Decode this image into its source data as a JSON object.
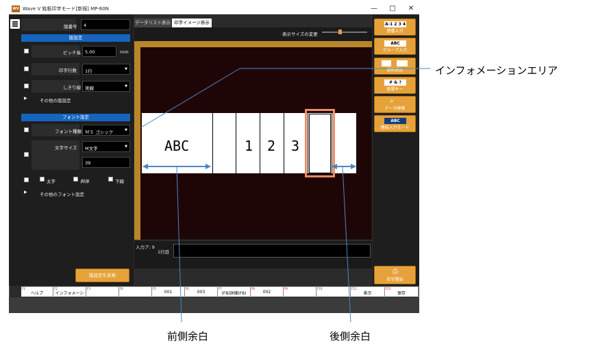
{
  "window": {
    "logo_text": "WV",
    "title": "Wave V 銘板印字モード[新規] MP-60N",
    "minimize": "—",
    "maximize": "□",
    "close": "✕"
  },
  "left": {
    "item_no_label": "版番号",
    "item_no_value": "4",
    "section_layout": "版設定",
    "pitch_label": "ピッチ長",
    "pitch_value": "5.00",
    "pitch_unit": "mm",
    "lines_label": "印字行数",
    "lines_value": "1行",
    "divider_label": "しきり線",
    "divider_value": "実線",
    "more_layout": "その他の版設定",
    "section_font": "フォント設定",
    "font_type_label": "フォント種類",
    "font_type_value": "ＭＳ ゴシック",
    "char_size_label": "文字サイズ",
    "char_size_value": "M文字",
    "char_size_num": "39",
    "bold_label": "太字",
    "italic_label": "斜体",
    "underline_label": "下線",
    "more_font": "その他のフォント設定",
    "apply_label": "版設定を反映"
  },
  "tabs": {
    "data_list": "データリスト表示",
    "print_image": "印字イメージ表示"
  },
  "image": {
    "size_change_label": "表示サイズの変更",
    "slider_fraction": 0.4,
    "cells": [
      "ABC",
      "",
      "1",
      "2",
      "3",
      "",
      ""
    ]
  },
  "input": {
    "input_label": "入力ア: 9",
    "line_label": "1行目"
  },
  "right_buttons": [
    {
      "icon": "A-1 2 3 4",
      "label": "連番入力"
    },
    {
      "icon": "ABC",
      "label": "グループ入力"
    },
    {
      "icon": "",
      "label": "透析読込"
    },
    {
      "icon": "# & ?",
      "label": "仮想キー"
    },
    {
      "icon": "",
      "label": "データ検索"
    },
    {
      "icon": "ABC",
      "label": "連結入力モード"
    }
  ],
  "print_button": "印字開始",
  "fn_bar": [
    {
      "key": "F1",
      "label": "ヘルプ"
    },
    {
      "key": "F2",
      "label": "インフォメーション"
    },
    {
      "key": "F3",
      "label": ""
    },
    {
      "key": "F4",
      "label": ""
    },
    {
      "key": "F5",
      "label": "001"
    },
    {
      "key": "F6",
      "label": "003"
    },
    {
      "key": "F7",
      "label": "(F8)詳細(F8)"
    },
    {
      "key": "F8",
      "label": "002"
    },
    {
      "key": "F9",
      "label": ""
    },
    {
      "key": "F10",
      "label": ""
    },
    {
      "key": "F11",
      "label": "表示"
    },
    {
      "key": "F12",
      "label": "保存"
    }
  ],
  "annotations": {
    "info_area": "インフォメーションエリア",
    "front_margin": "前側余白",
    "rear_margin": "後側余白"
  },
  "colors": {
    "accent_orange": "#e6a23a",
    "section_blue": "#1565c0",
    "highlight_box": "#f08a63",
    "arrow_blue": "#4b86c4"
  }
}
